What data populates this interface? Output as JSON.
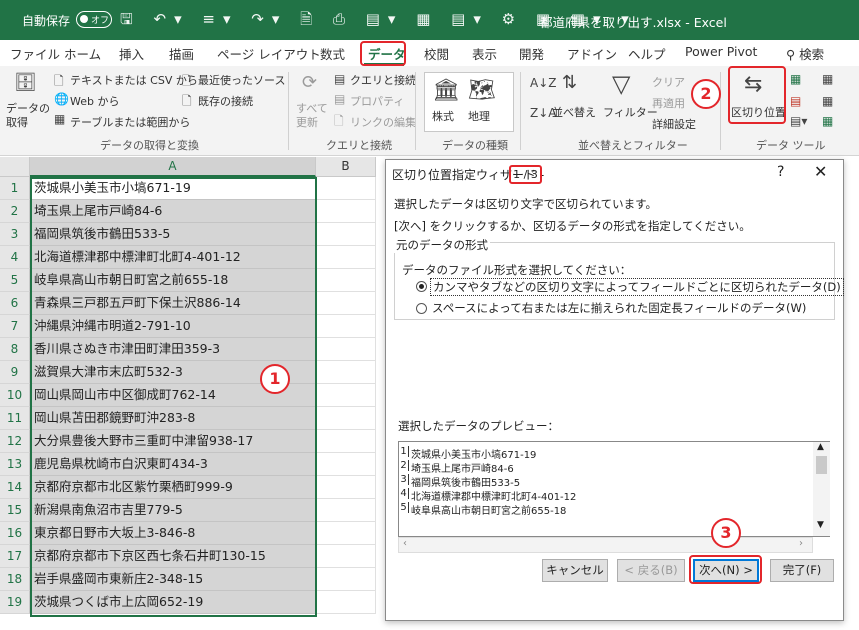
{
  "titlebar": {
    "autosave_label": "自動保存",
    "autosave_state": "オフ",
    "document_title": "都道府県を取り出す.xlsx  -  Excel"
  },
  "tabs": [
    {
      "label": "ファイル"
    },
    {
      "label": "ホーム"
    },
    {
      "label": "挿入"
    },
    {
      "label": "描画"
    },
    {
      "label": "ページ レイアウト"
    },
    {
      "label": "数式"
    },
    {
      "label": "データ",
      "active": true
    },
    {
      "label": "校閲"
    },
    {
      "label": "表示"
    },
    {
      "label": "開発"
    },
    {
      "label": "アドイン"
    },
    {
      "label": "ヘルプ"
    },
    {
      "label": "Power Pivot"
    },
    {
      "label": "検索"
    }
  ],
  "ribbon": {
    "get_data": "データの\n取得",
    "text_csv": "テキストまたは CSV から",
    "from_web": "Web から",
    "from_table": "テーブルまたは範囲から",
    "recent_sources": "最近使ったソース",
    "existing_connections": "既存の接続",
    "group_get_transform": "データの取得と変換",
    "refresh_all": "すべて\n更新",
    "queries_connections": "クエリと接続",
    "properties": "プロパティ",
    "edit_links": "リンクの編集",
    "group_queries": "クエリと接続",
    "stocks": "株式",
    "geography": "地理",
    "group_data_types": "データの種類",
    "sort": "並べ替え",
    "filter": "フィルター",
    "clear": "クリア",
    "reapply": "再適用",
    "advanced": "詳細設定",
    "group_sort_filter": "並べ替えとフィルター",
    "text_to_columns": "区切り位置",
    "group_data_tools": "データ ツール"
  },
  "annotations": {
    "one": "1",
    "two": "2",
    "three": "3"
  },
  "sheet": {
    "columns": [
      "A",
      "B"
    ],
    "rows": [
      {
        "n": "1",
        "a": "茨城県小美玉市小塙671-19"
      },
      {
        "n": "2",
        "a": "埼玉県上尾市戸崎84-6"
      },
      {
        "n": "3",
        "a": "福岡県筑後市鶴田533-5"
      },
      {
        "n": "4",
        "a": "北海道標津郡中標津町北町4-401-12"
      },
      {
        "n": "5",
        "a": "岐阜県高山市朝日町宮之前655-18"
      },
      {
        "n": "6",
        "a": "青森県三戸郡五戸町下保土沢886-14"
      },
      {
        "n": "7",
        "a": "沖縄県沖縄市明道2-791-10"
      },
      {
        "n": "8",
        "a": "香川県さぬき市津田町津田359-3"
      },
      {
        "n": "9",
        "a": "滋賀県大津市末広町532-3"
      },
      {
        "n": "10",
        "a": "岡山県岡山市中区御成町762-14"
      },
      {
        "n": "11",
        "a": "岡山県苫田郡鏡野町沖283-8"
      },
      {
        "n": "12",
        "a": "大分県豊後大野市三重町中津留938-17"
      },
      {
        "n": "13",
        "a": "鹿児島県枕崎市白沢東町434-3"
      },
      {
        "n": "14",
        "a": "京都府京都市北区紫竹栗栖町999-9"
      },
      {
        "n": "15",
        "a": "新潟県南魚沼市吉里779-5"
      },
      {
        "n": "16",
        "a": "東京都日野市大坂上3-846-8"
      },
      {
        "n": "17",
        "a": "京都府京都市下京区西七条石井町130-15"
      },
      {
        "n": "18",
        "a": "岩手県盛岡市東新庄2-348-15"
      },
      {
        "n": "19",
        "a": "茨城県つくば市上広岡652-19"
      }
    ]
  },
  "dialog": {
    "title": "区切り位置指定ウィザード -",
    "step": "1 / 3",
    "help": "?",
    "close": "✕",
    "line1": "選択したデータは区切り文字で区切られています。",
    "line2": "[次へ] をクリックするか、区切るデータの形式を指定してください。",
    "group_label": "元のデータの形式",
    "format_prompt": "データのファイル形式を選択してください：",
    "option_delimited": "カンマやタブなどの区切り文字によってフィールドごとに区切られたデータ(D)",
    "option_fixed": "スペースによって右または左に揃えられた固定長フィールドのデータ(W)",
    "preview_label": "選択したデータのプレビュー：",
    "preview_rows": [
      {
        "n": "1",
        "t": "茨城県小美玉市小塙671-19"
      },
      {
        "n": "2",
        "t": "埼玉県上尾市戸崎84-6"
      },
      {
        "n": "3",
        "t": "福岡県筑後市鶴田533-5"
      },
      {
        "n": "4",
        "t": "北海道標津郡中標津町北町4-401-12"
      },
      {
        "n": "5",
        "t": "岐阜県高山市朝日町宮之前655-18"
      }
    ],
    "buttons": {
      "cancel": "キャンセル",
      "back": "< 戻る(B)",
      "next": "次へ(N) >",
      "finish": "完了(F)"
    }
  },
  "colors": {
    "excel_green": "#217346",
    "annotation_red": "#e3262b",
    "dialog_default_blue": "#0078d7"
  }
}
